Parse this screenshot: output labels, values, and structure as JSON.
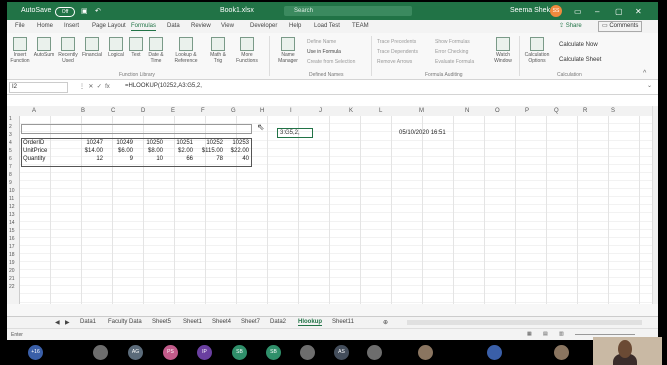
{
  "titlebar": {
    "autosave": "AutoSave",
    "autosave_state": "Off",
    "filename": "Book1.xlsx",
    "search": "Search",
    "user": "Seema Shekar",
    "user_initials": "SS"
  },
  "menu": {
    "tabs": [
      "File",
      "Home",
      "Insert",
      "Page Layout",
      "Formulas",
      "Data",
      "Review",
      "View",
      "Developer",
      "Help",
      "Load Test",
      "TEAM"
    ],
    "active_tab": "Formulas",
    "share": "Share",
    "comments": "Comments"
  },
  "ribbon": {
    "buttons": [
      {
        "label": "Insert Function"
      },
      {
        "label": "AutoSum"
      },
      {
        "label": "Recently Used"
      },
      {
        "label": "Financial"
      },
      {
        "label": "Logical"
      },
      {
        "label": "Text"
      },
      {
        "label": "Date & Time"
      },
      {
        "label": "Lookup & Reference"
      },
      {
        "label": "Math & Trig"
      },
      {
        "label": "More Functions"
      }
    ],
    "defined_names": [
      "Name Manager",
      "Define Name",
      "Use in Formula",
      "Create from Selection"
    ],
    "auditing": [
      "Trace Precedents",
      "Trace Dependents",
      "Remove Arrows",
      "Show Formulas",
      "Error Checking",
      "Evaluate Formula",
      "Watch Window"
    ],
    "calculation": [
      "Calculation Options",
      "Calculate Now",
      "Calculate Sheet"
    ],
    "groups": [
      "Function Library",
      "Defined Names",
      "Formula Auditing",
      "Calculation"
    ]
  },
  "formula_bar": {
    "name_box": "I2",
    "formula": "=HLOOKUP(10252,A3:G5,2,"
  },
  "columns": [
    "A",
    "B",
    "C",
    "D",
    "E",
    "F",
    "G",
    "H",
    "I",
    "J",
    "K",
    "L",
    "M",
    "N",
    "O",
    "P",
    "Q",
    "R",
    "S"
  ],
  "rows": [
    "1",
    "2",
    "3",
    "4",
    "5",
    "6",
    "7",
    "8",
    "9",
    "10",
    "11",
    "12",
    "13",
    "14",
    "15",
    "16",
    "17",
    "18",
    "19",
    "20",
    "21",
    "22"
  ],
  "table": {
    "headers": [
      "OrderID",
      "UnitPrice",
      "Quantity"
    ],
    "orderid": [
      "10247",
      "10249",
      "10250",
      "10251",
      "10252",
      "10253"
    ],
    "unitprice": [
      "$14.00",
      "$6.00",
      "$8.00",
      "$2.00",
      "$115.00",
      "$22.00"
    ],
    "quantity": [
      "12",
      "9",
      "10",
      "66",
      "78",
      "40"
    ]
  },
  "active_cell": "3:G5,2,",
  "date_cell": "05/10/2020 16:51",
  "sheets": [
    "Data1",
    "Faculty Data",
    "Sheet5",
    "Sheet1",
    "Sheet4",
    "Sheet7",
    "Data2",
    "Hlookup",
    "Sheet11"
  ],
  "active_sheet": "Hlookup",
  "status": "Enter",
  "participants": [
    {
      "label": "+16",
      "color": "#3a5fa8"
    },
    {
      "label": "",
      "color": "#6d6d6d"
    },
    {
      "label": "AG",
      "color": "#5b6b7a"
    },
    {
      "label": "PS",
      "color": "#c25b8a"
    },
    {
      "label": "IP",
      "color": "#6a3fa0"
    },
    {
      "label": "SB",
      "color": "#2f8f6a"
    },
    {
      "label": "SB",
      "color": "#2f8f6a"
    },
    {
      "label": "",
      "color": "#6d6d6d"
    },
    {
      "label": "AS",
      "color": "#444e5c"
    },
    {
      "label": "",
      "color": "#6d6d6d"
    },
    {
      "label": "",
      "color": "#8a7560"
    },
    {
      "label": "",
      "color": "#3a5fa8"
    },
    {
      "label": "",
      "color": "#8a7560"
    }
  ]
}
